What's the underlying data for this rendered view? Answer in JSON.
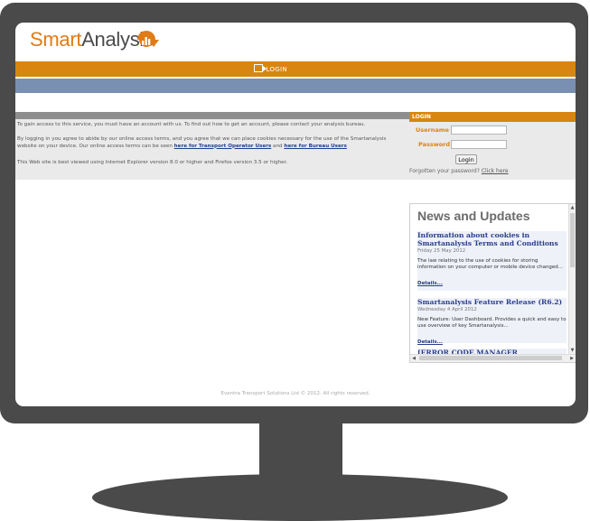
{
  "header": {
    "logo_part1": "Smart",
    "logo_part2": "Analysis",
    "login_link": "LOGIN"
  },
  "info": {
    "line1": "To gain access to this service, you must have an account with us. To find out how to get an account, please contact your analysis bureau.",
    "line2_pre": "By logging in you agree to abide by our online access terms, and you agree that we can place cookies necessary for the use of the Smartanalysis website on your device. Our online access terms can be seen ",
    "link_transport": "here for Transport Operator Users",
    "line2_mid": " and ",
    "link_bureau": "here for Bureau Users",
    "line3": "This Web site is best viewed using Internet Explorer version 8.0 or higher and Firefox version 3.5 or higher."
  },
  "login": {
    "heading": "LOGIN",
    "username_label": "Username",
    "password_label": "Password",
    "button": "Login",
    "forgot_text": "Forgotten your password? ",
    "forgot_link": "Click here"
  },
  "news": {
    "title": "News and Updates",
    "items": [
      {
        "headline": "Information about cookies in Smartanalysis Terms and Conditions",
        "date": "Friday 25 May 2012",
        "text": "The law relating to the use of cookies for storing information on your computer or mobile device changed...",
        "link": "Details..."
      },
      {
        "headline": "Smartanalysis Feature Release (R6.2)",
        "date": "Wednesday 4 April 2012",
        "text": "New Feature: User Dashboard. Provides a quick and easy to use overview of key Smartanalysis...",
        "link": "Details..."
      }
    ],
    "third_partial": "[ERROR CODE MANAGER PROGRAMMES"
  },
  "footer": "Eventra Transport Solutions Ltd © 2012. All rights reserved.",
  "colors": {
    "orange": "#d8860f",
    "blue_bar": "#7a90b2",
    "bezel": "#4a4a4a"
  }
}
